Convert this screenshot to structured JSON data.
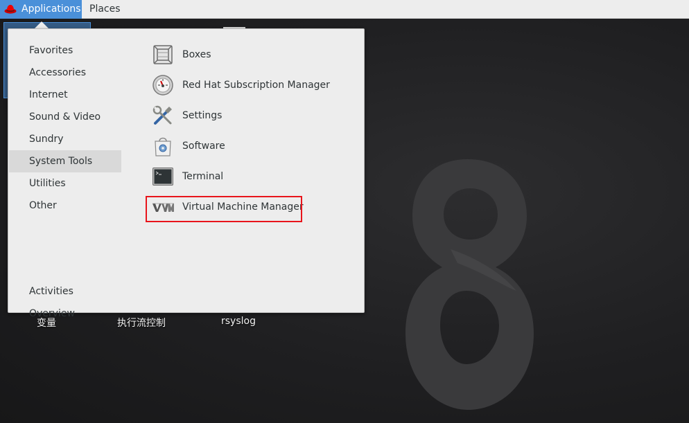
{
  "topbar": {
    "applications_label": "Applications",
    "places_label": "Places"
  },
  "menu": {
    "categories": [
      {
        "label": "Favorites"
      },
      {
        "label": "Accessories"
      },
      {
        "label": "Internet"
      },
      {
        "label": "Sound & Video"
      },
      {
        "label": "Sundry"
      },
      {
        "label": "System Tools",
        "selected": true
      },
      {
        "label": "Utilities"
      },
      {
        "label": "Other"
      }
    ],
    "activities_overview": "Activities Overview",
    "apps": [
      {
        "label": "Boxes",
        "icon": "boxes-icon"
      },
      {
        "label": "Red Hat Subscription Manager",
        "icon": "subscription-manager-icon"
      },
      {
        "label": "Settings",
        "icon": "settings-icon"
      },
      {
        "label": "Software",
        "icon": "software-icon"
      },
      {
        "label": "Terminal",
        "icon": "terminal-icon"
      },
      {
        "label": "Virtual Machine Manager",
        "icon": "vmm-icon",
        "highlighted": true
      }
    ]
  },
  "desktop": {
    "icon_labels": [
      "变量",
      "执行流控制",
      "rsyslog"
    ]
  },
  "colors": {
    "accent": "#4a90d9",
    "highlight_box": "#e8141b",
    "menu_bg": "#ededed"
  }
}
